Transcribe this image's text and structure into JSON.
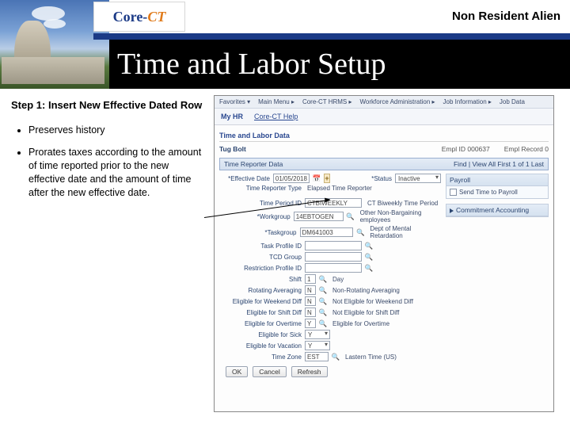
{
  "header": {
    "logo_core": "Core-",
    "logo_ct": "CT",
    "doc_title": "Non Resident Alien",
    "slide_title": "Time and Labor Setup"
  },
  "left": {
    "step_title": "Step 1: Insert New Effective Dated Row",
    "bullet1": "Preserves history",
    "bullet2": "Prorates taxes according to the amount of time reported prior to the new effective date and the amount of time after the new effective date."
  },
  "app": {
    "crumbs": [
      "Favorites ▾",
      "Main Menu ▸",
      "Core-CT HRMS ▸",
      "Workforce Administration ▸",
      "Job Information ▸",
      "Job Data"
    ],
    "tab1": "My HR",
    "tab2": "Core-CT Help",
    "section_hdr": "Time and Labor Data",
    "person_name": "Tug Bolt",
    "emplid_lbl": "Empl ID",
    "emplid_val": "000637",
    "emplrcd_lbl": "Empl Record",
    "emplrcd_val": "0",
    "tr_hdr": "Time Reporter Data",
    "tr_nav": "Find | View All    First  1 of 1  Last",
    "rows": {
      "effdt_lbl": "*Effective Date",
      "effdt_val": "01/05/2018",
      "status_lbl": "*Status",
      "status_val": "Inactive",
      "trtype_lbl": "Time Reporter Type",
      "trtype_val": "Elapsed Time Reporter",
      "period_lbl": "Time Period ID",
      "period_val": "CTBIWEEKLY",
      "period_desc": "CT Biweekly Time Period",
      "workgroup_lbl": "*Workgroup",
      "workgroup_val": "14EBTOGEN",
      "workgroup_desc": "Other Non-Bargaining employees",
      "taskgroup_lbl": "*Taskgroup",
      "taskgroup_val": "DM641003",
      "taskgroup_desc": "Dept of Mental Retardation",
      "taskprof_lbl": "Task Profile ID",
      "tcdgroup_lbl": "TCD Group",
      "restrict_lbl": "Restriction Profile ID",
      "shift_lbl": "Shift",
      "shift_val": "1",
      "shift_desc": "Day",
      "rot_lbl": "Rotating Averaging",
      "rot_val": "N",
      "rot_desc": "Non-Rotating Averaging",
      "wkd_lbl": "Eligible for Weekend Diff",
      "wkd_val": "N",
      "wkd_desc": "Not Eligible for Weekend Diff",
      "sd_lbl": "Eligible for Shift Diff",
      "sd_val": "N",
      "sd_desc": "Not Eligible for Shift Diff",
      "ot_lbl": "Eligible for Overtime",
      "ot_val": "Y",
      "ot_desc": "Eligible for Overtime",
      "sick_lbl": "Eligible for Sick",
      "sick_val": "Y",
      "vac_lbl": "Eligible for Vacation",
      "vac_val": "Y",
      "tz_lbl": "Time Zone",
      "tz_val": "EST",
      "lastern_lbl": "Lastern Time (US)"
    },
    "side": {
      "payroll_hdr": "Payroll",
      "payroll_chk": "Send Time to Payroll",
      "commit_hdr": "Commitment Accounting"
    },
    "buttons": {
      "ok": "OK",
      "cancel": "Cancel",
      "refresh": "Refresh"
    }
  }
}
